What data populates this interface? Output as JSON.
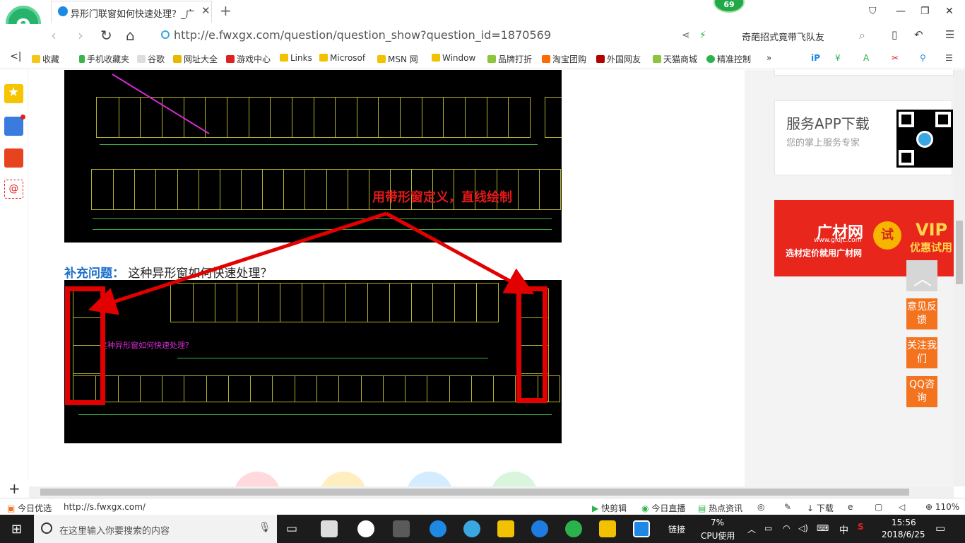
{
  "browser": {
    "tab_title": "异形门联窗如何快速处理？_广联",
    "badge_count": "69",
    "url": "http://e.fwxgx.com/question/question_show?question_id=1870569",
    "search_text": "奇葩招式竟带飞队友"
  },
  "bookmarks": [
    "收藏",
    "手机收藏夹",
    "谷歌",
    "网址大全",
    "游戏中心",
    "Links",
    "Microsof",
    "MSN 网",
    "Window",
    "品牌打折",
    "淘宝团购",
    "外国网友",
    "天猫商城",
    "精准控制"
  ],
  "content": {
    "cad_annotation_red": "用带形窗定义，直线绘制",
    "supplement_label": "补充问题：",
    "supplement_text": "这种异形窗如何快速处理？",
    "cad_annotation_magenta": "这种异形窗如何快速处理?"
  },
  "right": {
    "app_title": "服务APP下载",
    "app_sub": "您的掌上服务专家",
    "ad_brand": "广材网",
    "ad_url": "www.gldjc.com",
    "ad_slogan": "选材定价就用广材网",
    "ad_try": "试",
    "ad_vip": "VIP",
    "ad_promo": "优惠试用",
    "feedback": "意见反馈",
    "follow": "关注我们",
    "qq": "QQ咨询"
  },
  "status": {
    "left_label": "今日优选",
    "url": "http://s.fwxgx.com/",
    "items": [
      "快剪辑",
      "今日直播",
      "热点资讯",
      "下载"
    ],
    "zoom": "110%"
  },
  "taskbar": {
    "search_placeholder": "在这里输入你要搜索的内容",
    "link_label": "链接",
    "cpu_percent": "7%",
    "cpu_label": "CPU使用",
    "ime": "中",
    "time": "15:56",
    "date": "2018/6/25"
  },
  "colors": {
    "accent": "#1b6fcb",
    "red": "#e30000",
    "orange": "#f4731f",
    "cad_yellow": "#b5b22a"
  }
}
